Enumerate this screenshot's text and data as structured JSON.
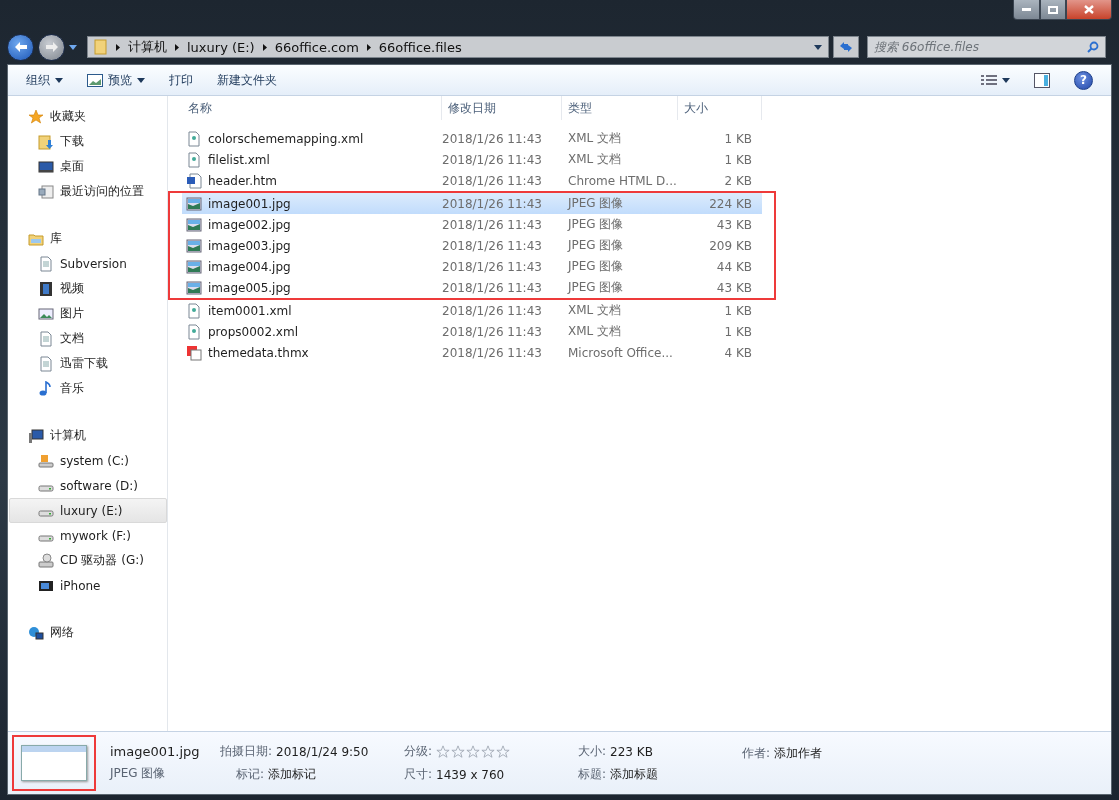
{
  "address": {
    "crumbs": [
      "计算机",
      "luxury (E:)",
      "66office.com",
      "66office.files"
    ]
  },
  "search": {
    "placeholder": "搜索 66office.files"
  },
  "toolbar": {
    "buttons": [
      {
        "label": "组织",
        "kind": "menu"
      },
      {
        "label": "预览",
        "kind": "preview"
      },
      {
        "label": "打印",
        "kind": "plain"
      },
      {
        "label": "新建文件夹",
        "kind": "plain"
      }
    ],
    "help": "?"
  },
  "sidebar": {
    "groups": [
      {
        "label": "收藏夹",
        "kind": "star",
        "children": [
          {
            "label": "下载",
            "kind": "download",
            "selected": false
          },
          {
            "label": "桌面",
            "kind": "desktop",
            "selected": false
          },
          {
            "label": "最近访问的位置",
            "kind": "recent",
            "selected": false
          }
        ]
      },
      {
        "label": "库",
        "kind": "library",
        "children": [
          {
            "label": "Subversion",
            "kind": "doc",
            "selected": false
          },
          {
            "label": "视频",
            "kind": "video",
            "selected": false
          },
          {
            "label": "图片",
            "kind": "picture",
            "selected": false
          },
          {
            "label": "文档",
            "kind": "doc",
            "selected": false
          },
          {
            "label": "迅雷下载",
            "kind": "doc",
            "selected": false
          },
          {
            "label": "音乐",
            "kind": "music",
            "selected": false
          }
        ]
      },
      {
        "label": "计算机",
        "kind": "computer",
        "children": [
          {
            "label": "system (C:)",
            "kind": "sysdrive",
            "selected": false
          },
          {
            "label": "software (D:)",
            "kind": "drive",
            "selected": false
          },
          {
            "label": "luxury (E:)",
            "kind": "drive",
            "selected": true
          },
          {
            "label": "mywork (F:)",
            "kind": "drive",
            "selected": false
          },
          {
            "label": "CD 驱动器 (G:)",
            "kind": "cd",
            "selected": false
          },
          {
            "label": "iPhone",
            "kind": "device",
            "selected": false
          }
        ]
      },
      {
        "label": "网络",
        "kind": "network"
      }
    ]
  },
  "table": {
    "columns": [
      "名称",
      "修改日期",
      "类型",
      "大小"
    ],
    "rows": [
      {
        "name": "colorschememapping.xml",
        "kind": "xml",
        "date": "2018/1/26 11:43",
        "type": "XML 文档",
        "size": "1 KB",
        "selected": false,
        "marked": false
      },
      {
        "name": "filelist.xml",
        "kind": "xml",
        "date": "2018/1/26 11:43",
        "type": "XML 文档",
        "size": "1 KB",
        "selected": false,
        "marked": false
      },
      {
        "name": "header.htm",
        "kind": "htm",
        "date": "2018/1/26 11:43",
        "type": "Chrome HTML D...",
        "size": "2 KB",
        "selected": false,
        "marked": false
      },
      {
        "name": "image001.jpg",
        "kind": "jpg",
        "date": "2018/1/26 11:43",
        "type": "JPEG 图像",
        "size": "224 KB",
        "selected": true,
        "marked": true
      },
      {
        "name": "image002.jpg",
        "kind": "jpg",
        "date": "2018/1/26 11:43",
        "type": "JPEG 图像",
        "size": "43 KB",
        "selected": false,
        "marked": true
      },
      {
        "name": "image003.jpg",
        "kind": "jpg",
        "date": "2018/1/26 11:43",
        "type": "JPEG 图像",
        "size": "209 KB",
        "selected": false,
        "marked": true
      },
      {
        "name": "image004.jpg",
        "kind": "jpg",
        "date": "2018/1/26 11:43",
        "type": "JPEG 图像",
        "size": "44 KB",
        "selected": false,
        "marked": true
      },
      {
        "name": "image005.jpg",
        "kind": "jpg",
        "date": "2018/1/26 11:43",
        "type": "JPEG 图像",
        "size": "43 KB",
        "selected": false,
        "marked": true
      },
      {
        "name": "item0001.xml",
        "kind": "xml",
        "date": "2018/1/26 11:43",
        "type": "XML 文档",
        "size": "1 KB",
        "selected": false,
        "marked": false
      },
      {
        "name": "props0002.xml",
        "kind": "xml",
        "date": "2018/1/26 11:43",
        "type": "XML 文档",
        "size": "1 KB",
        "selected": false,
        "marked": false
      },
      {
        "name": "themedata.thmx",
        "kind": "thmx",
        "date": "2018/1/26 11:43",
        "type": "Microsoft Office...",
        "size": "4 KB",
        "selected": false,
        "marked": false
      }
    ]
  },
  "details": {
    "thumbnail_marked": true,
    "name": "image001.jpg",
    "type": "JPEG 图像",
    "stars": 0,
    "fields": [
      {
        "label": "拍摄日期:",
        "value": "2018/1/24 9:50"
      },
      {
        "label": "标记:",
        "value": "添加标记"
      },
      {
        "label": "分级:"
      },
      {
        "label": "尺寸:",
        "value": "1439 x 760"
      },
      {
        "label": "大小:",
        "value": "223 KB"
      },
      {
        "label": "标题:",
        "value": "添加标题"
      },
      {
        "label": "作者:",
        "value": "添加作者"
      }
    ]
  }
}
